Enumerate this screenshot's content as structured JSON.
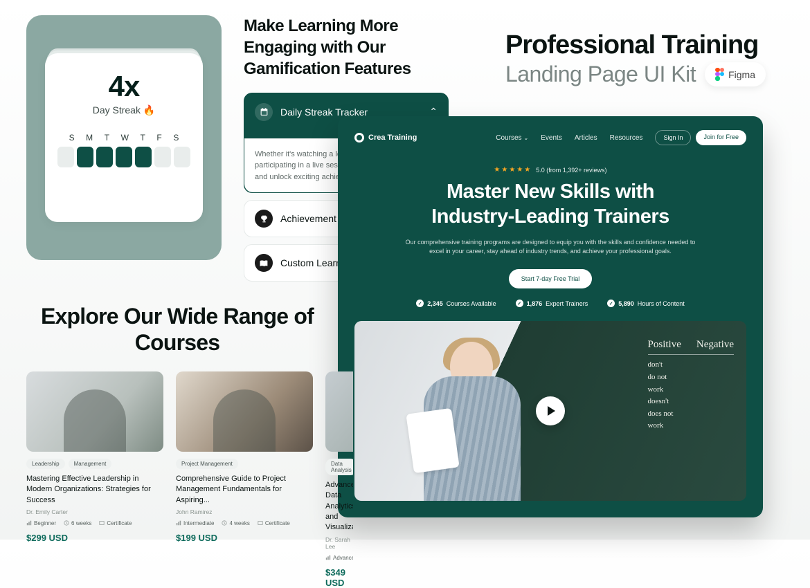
{
  "streak": {
    "value": "4x",
    "label": "Day Streak 🔥",
    "days": [
      "S",
      "M",
      "T",
      "W",
      "T",
      "F",
      "S"
    ],
    "active": [
      false,
      true,
      true,
      true,
      true,
      false,
      false
    ]
  },
  "gamification": {
    "title": "Make Learning More Engaging with Our Gamification Features",
    "items": [
      {
        "label": "Daily Streak Tracker",
        "body": "Whether it's watching a lesson, completing a quiz, or participating in a live session, keep your streak alive and unlock exciting achievements."
      },
      {
        "label": "Achievement Ladder"
      },
      {
        "label": "Custom Learning"
      }
    ]
  },
  "promo": {
    "heading": "Professional Training",
    "sub": "Landing Page UI Kit",
    "badge": "Figma"
  },
  "hero": {
    "brand": "Crea Training",
    "nav": [
      "Courses",
      "Events",
      "Articles",
      "Resources"
    ],
    "signin": "Sign In",
    "join": "Join for Free",
    "rating_text": "5.0 (from 1,392+ reviews)",
    "heading_l1": "Master New Skills with",
    "heading_l2": "Industry-Leading Trainers",
    "desc": "Our comprehensive training programs are designed to equip you with the skills and confidence needed to excel in your career, stay ahead of industry trends, and achieve your professional goals.",
    "cta": "Start 7-day Free Trial",
    "stats": [
      {
        "num": "2,345",
        "label": "Courses Available"
      },
      {
        "num": "1,876",
        "label": "Expert Trainers"
      },
      {
        "num": "5,890",
        "label": "Hours of Content"
      }
    ],
    "board": {
      "pos": "Positive",
      "neg": "Negative",
      "neg_items": [
        "don't",
        "do not",
        "work",
        "doesn't",
        "does not",
        "work"
      ]
    }
  },
  "courses": {
    "heading": "Explore Our Wide Range of Courses",
    "list": [
      {
        "tags": [
          "Leadership",
          "Management"
        ],
        "title": "Mastering Effective Leadership in Modern Organizations: Strategies for Success",
        "author": "Dr. Emily Carter",
        "level": "Beginner",
        "duration": "6 weeks",
        "cert": "Certificate",
        "price": "$299 USD"
      },
      {
        "tags": [
          "Project Management"
        ],
        "title": "Comprehensive Guide to Project Management Fundamentals for Aspiring...",
        "author": "John Ramirez",
        "level": "Intermediate",
        "duration": "4 weeks",
        "cert": "Certificate",
        "price": "$199 USD"
      },
      {
        "tags": [
          "Data Analysis"
        ],
        "title": "Advanced Data Analytics and Visualization",
        "author": "Dr. Sarah Lee",
        "level": "Advanced",
        "duration": "",
        "cert": "",
        "price": "$349 USD"
      }
    ]
  }
}
